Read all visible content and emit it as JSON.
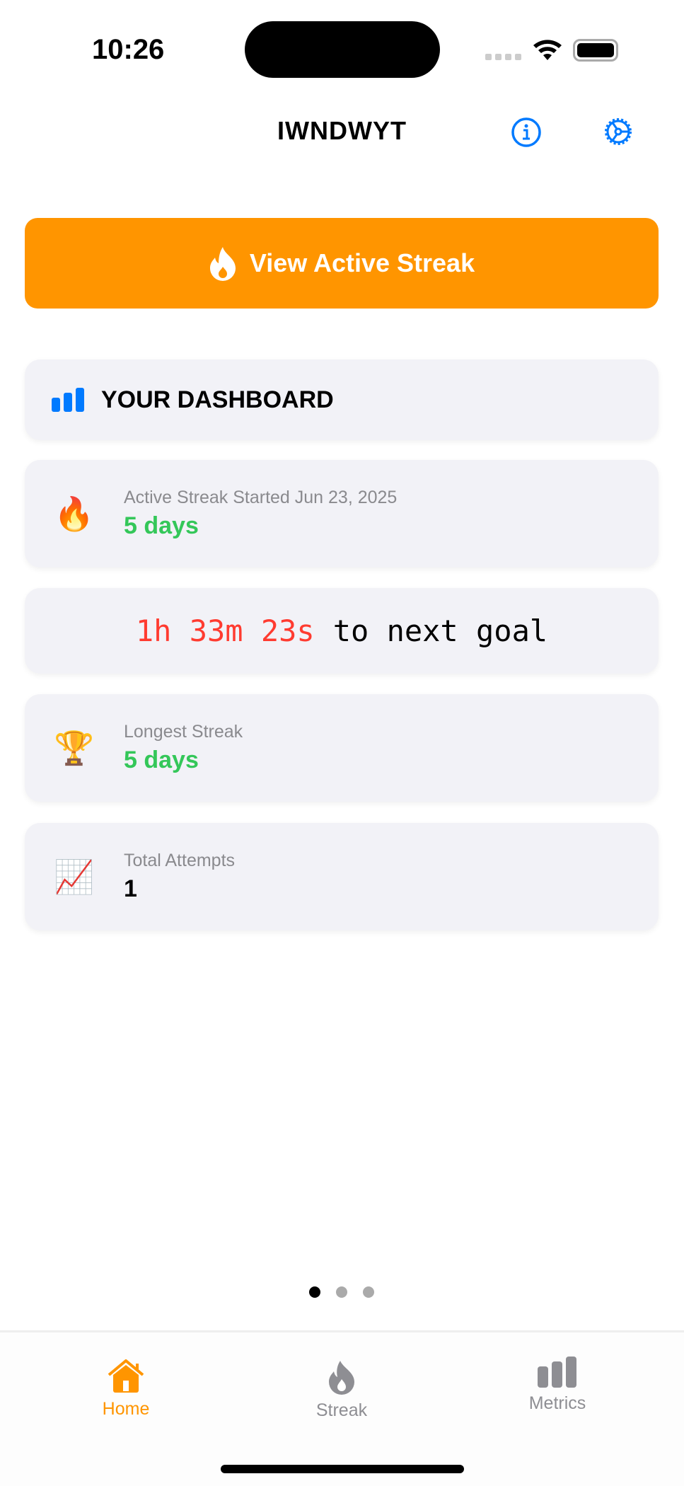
{
  "status_bar": {
    "time": "10:26"
  },
  "nav": {
    "title": "IWNDWYT"
  },
  "cta": {
    "label": "View Active Streak"
  },
  "dashboard": {
    "heading": "YOUR DASHBOARD"
  },
  "active_streak": {
    "emoji": "🔥",
    "label": "Active Streak Started Jun 23, 2025",
    "value": "5 days"
  },
  "timer": {
    "countdown": "1h 33m 23s",
    "suffix": "to next goal"
  },
  "longest_streak": {
    "emoji": "🏆",
    "label": "Longest Streak",
    "value": "5 days"
  },
  "total_attempts": {
    "emoji": "📈",
    "label": "Total Attempts",
    "value": "1"
  },
  "pager": {
    "pages": 3,
    "current": 1
  },
  "tabs": [
    {
      "label": "Home",
      "active": true
    },
    {
      "label": "Streak"
    },
    {
      "label": "Metrics"
    }
  ],
  "colors": {
    "accent": "#ff9500",
    "blue": "#007aff",
    "green": "#34c759",
    "red": "#ff3b30"
  }
}
